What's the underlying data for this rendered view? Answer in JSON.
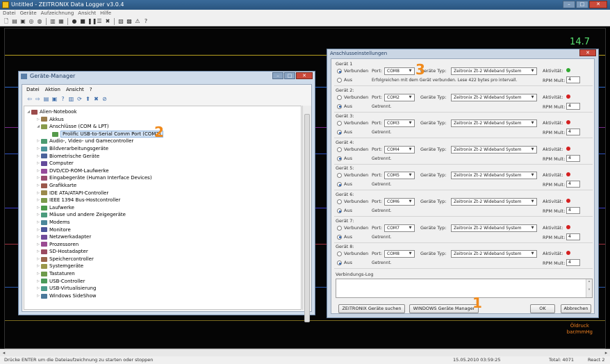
{
  "app": {
    "title": "Untitled - ZEITRONIX Data Logger v3.0.4",
    "menu": [
      "Datei",
      "Geräte",
      "Aufzeichnung",
      "Ansicht",
      "Hilfe"
    ],
    "gauge_value": "14.7",
    "oil_label_line1": "Öldruck",
    "oil_label_line2": "bar/mmHg"
  },
  "status": {
    "hint": "Drücke ENTER um die Dateiaufzeichnung zu starten oder stoppen",
    "datetime": "15.05.2010 03:59:25",
    "total": "Total: 4071",
    "react": "React 2"
  },
  "device_manager": {
    "title": "Geräte-Manager",
    "menu": [
      "Datei",
      "Aktion",
      "Ansicht",
      "?"
    ],
    "tree": [
      "Alien-Notebook",
      "Akkus",
      "Anschlüsse (COM & LPT)",
      "Prolific USB-to-Serial Comm Port (COM2)",
      "Audio-, Video- und Gamecontroller",
      "Bildverarbeitungsgeräte",
      "Biometrische Geräte",
      "Computer",
      "DVD/CD-ROM-Laufwerke",
      "Eingabegeräte (Human Interface Devices)",
      "Grafikkarte",
      "IDE ATA/ATAPI-Controller",
      "IEEE 1394 Bus-Hostcontroller",
      "Laufwerke",
      "Mäuse und andere Zeigegeräte",
      "Modems",
      "Monitore",
      "Netzwerkadapter",
      "Prozessoren",
      "SD-Hostadapter",
      "Speichercontroller",
      "Systemgeräte",
      "Tastaturen",
      "USB-Controller",
      "USB-Virtualisierung",
      "Windows SideShow"
    ]
  },
  "callouts": {
    "one": "1",
    "two": "2",
    "three": "3"
  },
  "connection_dialog": {
    "title": "Anschlusseinstellungen",
    "labels": {
      "connected": "Verbunden",
      "off": "Aus",
      "port": "Port:",
      "device_type": "Geräte Typ:",
      "activity": "Aktivität:",
      "rpm": "RPM Mult:"
    },
    "devices": [
      {
        "name": "Gerät 1",
        "port": "COM8",
        "type": "Zeitronix Zt-2 Wideband System",
        "connected": true,
        "status": "Erfolgreichen mit dem Gerät verbunden. Lese 422 bytes pro intervall.",
        "activity_color": "#2fa82f",
        "rpm": "4"
      },
      {
        "name": "Gerät 2:",
        "port": "COM2",
        "type": "Zeitronix Zt-2 Wideband System",
        "connected": false,
        "status": "Getrennt.",
        "activity_color": "#d42020",
        "rpm": "4"
      },
      {
        "name": "Gerät 3:",
        "port": "COM3",
        "type": "Zeitronix Zt-2 Wideband System",
        "connected": false,
        "status": "Getrennt.",
        "activity_color": "#d42020",
        "rpm": "4"
      },
      {
        "name": "Gerät 4:",
        "port": "COM4",
        "type": "Zeitronix Zt-2 Wideband System",
        "connected": false,
        "status": "Getrennt.",
        "activity_color": "#d42020",
        "rpm": "4"
      },
      {
        "name": "Gerät 5:",
        "port": "COM5",
        "type": "Zeitronix Zt-2 Wideband System",
        "connected": false,
        "status": "Getrennt.",
        "activity_color": "#d42020",
        "rpm": "4"
      },
      {
        "name": "Gerät 6:",
        "port": "COM6",
        "type": "Zeitronix Zt-2 Wideband System",
        "connected": false,
        "status": "Getrennt.",
        "activity_color": "#d42020",
        "rpm": "4"
      },
      {
        "name": "Gerät 7:",
        "port": "COM7",
        "type": "Zeitronix Zt-2 Wideband System",
        "connected": false,
        "status": "Getrennt.",
        "activity_color": "#d42020",
        "rpm": "4"
      },
      {
        "name": "Gerät 8:",
        "port": "COM8",
        "type": "Zeitronix Zt-2 Wideband System",
        "connected": false,
        "status": "Getrennt.",
        "activity_color": "#d42020",
        "rpm": "4"
      }
    ],
    "log_label": "Verbindungs-Log",
    "buttons": {
      "search": "ZEITRONIX Geräte suchen",
      "windows_dm": "WINDOWS Geräte Manager",
      "ok": "OK",
      "cancel": "Abbrechen"
    }
  }
}
